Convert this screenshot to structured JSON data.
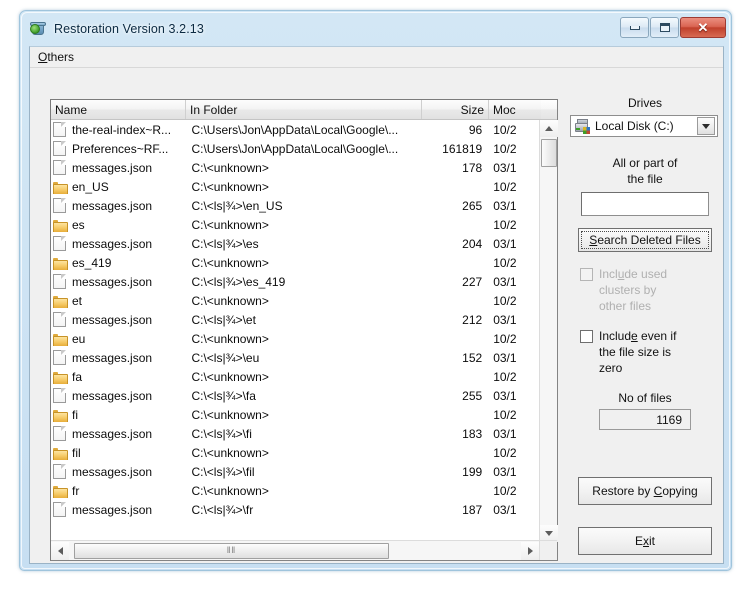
{
  "window": {
    "title": "Restoration Version 3.2.13",
    "app_icon": "recycle-bin-icon",
    "minimize_label": "",
    "maximize_label": "",
    "close_label": "✕"
  },
  "menu": {
    "items": [
      {
        "label": "Others",
        "accel": "O"
      }
    ]
  },
  "list": {
    "columns": [
      {
        "key": "name",
        "label": "Name"
      },
      {
        "key": "folder",
        "label": "In Folder"
      },
      {
        "key": "size",
        "label": "Size"
      },
      {
        "key": "mod",
        "label": "Moc"
      }
    ],
    "rows": [
      {
        "icon": "file",
        "name": "the-real-index~R...",
        "folder": "C:\\Users\\Jon\\AppData\\Local\\Google\\...",
        "size": "96",
        "mod": "10/2"
      },
      {
        "icon": "file",
        "name": "Preferences~RF...",
        "folder": "C:\\Users\\Jon\\AppData\\Local\\Google\\...",
        "size": "161819",
        "mod": "10/2"
      },
      {
        "icon": "file",
        "name": "messages.json",
        "folder": "C:\\<unknown>",
        "size": "178",
        "mod": "03/1"
      },
      {
        "icon": "folder",
        "name": "en_US",
        "folder": "C:\\<unknown>",
        "size": "",
        "mod": "10/2"
      },
      {
        "icon": "file",
        "name": "messages.json",
        "folder": "C:\\<ls|¾>\\en_US",
        "size": "265",
        "mod": "03/1"
      },
      {
        "icon": "folder",
        "name": "es",
        "folder": "C:\\<unknown>",
        "size": "",
        "mod": "10/2"
      },
      {
        "icon": "file",
        "name": "messages.json",
        "folder": "C:\\<ls|¾>\\es",
        "size": "204",
        "mod": "03/1"
      },
      {
        "icon": "folder",
        "name": "es_419",
        "folder": "C:\\<unknown>",
        "size": "",
        "mod": "10/2"
      },
      {
        "icon": "file",
        "name": "messages.json",
        "folder": "C:\\<ls|¾>\\es_419",
        "size": "227",
        "mod": "03/1"
      },
      {
        "icon": "folder",
        "name": "et",
        "folder": "C:\\<unknown>",
        "size": "",
        "mod": "10/2"
      },
      {
        "icon": "file",
        "name": "messages.json",
        "folder": "C:\\<ls|¾>\\et",
        "size": "212",
        "mod": "03/1"
      },
      {
        "icon": "folder",
        "name": "eu",
        "folder": "C:\\<unknown>",
        "size": "",
        "mod": "10/2"
      },
      {
        "icon": "file",
        "name": "messages.json",
        "folder": "C:\\<ls|¾>\\eu",
        "size": "152",
        "mod": "03/1"
      },
      {
        "icon": "folder",
        "name": "fa",
        "folder": "C:\\<unknown>",
        "size": "",
        "mod": "10/2"
      },
      {
        "icon": "file",
        "name": "messages.json",
        "folder": "C:\\<ls|¾>\\fa",
        "size": "255",
        "mod": "03/1"
      },
      {
        "icon": "folder",
        "name": "fi",
        "folder": "C:\\<unknown>",
        "size": "",
        "mod": "10/2"
      },
      {
        "icon": "file",
        "name": "messages.json",
        "folder": "C:\\<ls|¾>\\fi",
        "size": "183",
        "mod": "03/1"
      },
      {
        "icon": "folder",
        "name": "fil",
        "folder": "C:\\<unknown>",
        "size": "",
        "mod": "10/2"
      },
      {
        "icon": "file",
        "name": "messages.json",
        "folder": "C:\\<ls|¾>\\fil",
        "size": "199",
        "mod": "03/1"
      },
      {
        "icon": "folder",
        "name": "fr",
        "folder": "C:\\<unknown>",
        "size": "",
        "mod": "10/2"
      },
      {
        "icon": "file",
        "name": "messages.json",
        "folder": "C:\\<ls|¾>\\fr",
        "size": "187",
        "mod": "03/1"
      }
    ],
    "h_scroll_grip": "‖‖"
  },
  "panel": {
    "drives_label": "Drives",
    "drive_selected": "Local Disk (C:)",
    "drive_icon": "hard-disk-icon",
    "filter_label_line1": "All or part of",
    "filter_label_line2": "the file",
    "filter_value": "",
    "filter_placeholder": "",
    "search_button": "Search Deleted Files",
    "search_button_accel": "S",
    "checkbox_used_clusters": {
      "line1": "Include used",
      "line2": "clusters by",
      "line3": "other files",
      "accel": "u",
      "checked": false,
      "disabled": true
    },
    "checkbox_zero_size": {
      "line1": "Include even if",
      "line2": "the file size is",
      "line3": "zero",
      "accel": "e",
      "checked": false,
      "disabled": false
    },
    "count_label": "No of files",
    "count_value": "1169",
    "restore_button": "Restore by Copying",
    "restore_button_accel": "C",
    "exit_button": "Exit",
    "exit_button_accel": "x"
  },
  "colors": {
    "frame": "#cfe4f4",
    "client": "#f0f0f0",
    "close_button": "#c0402c",
    "folder_icon": "#f0c45c",
    "page_background": "#ffffff"
  }
}
